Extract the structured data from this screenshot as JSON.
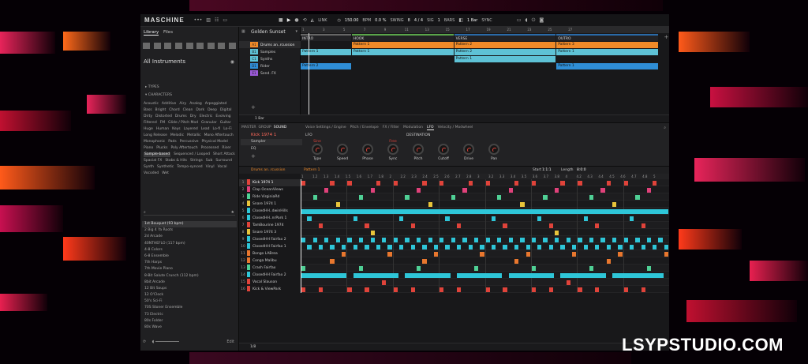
{
  "app": {
    "logo": "MASCHINE",
    "dots": "•••",
    "position": "1",
    "bpm": "150.00",
    "bpm_label": "BPM",
    "swing": "0.0 %",
    "swing_label": "SWING",
    "signature": "4 / 4",
    "signature_label": "SIG",
    "bar_num": "8",
    "bars_label": "BARS",
    "link_label": "LINK",
    "bar_length": "1 Bar",
    "sync_label": "SYNC",
    "accent": "#f08a28"
  },
  "browser": {
    "tabs": [
      "Library",
      "Files"
    ],
    "title": "All Instruments",
    "types_label": "TYPES",
    "characters_label": "CHARACTERS",
    "characters": [
      "Acoustic",
      "Additive",
      "Airy",
      "Analog",
      "Arpeggiated",
      "Bass",
      "Bright",
      "Chord",
      "Clean",
      "Dark",
      "Deep",
      "Digital",
      "Dirty",
      "Distorted",
      "Drums",
      "Dry",
      "Electric",
      "Evolving",
      "Filtered",
      "FM",
      "Glide / Pitch Mod",
      "Granular",
      "Guitar",
      "Huge",
      "Human",
      "Keys",
      "Layered",
      "Lead",
      "Lo-fi",
      "Lo-Fi",
      "Long Release",
      "Melodic",
      "Metallic",
      "Mono Aftertouch",
      "Monophonic",
      "Pads",
      "Percussive",
      "Physical Model",
      "Piano",
      "Plucks",
      "Poly Aftertouch",
      "Processed",
      "Riser",
      "Sample-based",
      "Sequenced / Looped",
      "Short Attack",
      "Spacial FX",
      "Stabs & Hits",
      "Strings",
      "Sub",
      "Surround",
      "Synth",
      "Synthetic",
      "Tempo-synced",
      "Vinyl",
      "Vocal",
      "Vocoded",
      "Wet"
    ],
    "selected_character": "Sample-based",
    "results": [
      "1st Bouquet (93 bpm)",
      "2 Big 4 Ya Roots",
      "2d Arcade",
      "40NTHEFLO (117 bpm)",
      "4-8 Colors",
      "6-8 Ensemble",
      "7th Harps",
      "7th Movie Piano",
      "8-Bit Salute Crunch (112 bpm)",
      "8bit Arcade",
      "12 Bit Soups",
      "12 O'Clock",
      "50's Sci-Fi",
      "70S Stoner Ensemble",
      "73 Electric",
      "80s Folder",
      "80s Wave"
    ],
    "selected_result": "1st Bouquet (93 bpm)",
    "edit_label": "Edit"
  },
  "arranger": {
    "song_name": "Golden Sunset",
    "groups": [
      {
        "code": "A1",
        "name": "Drums an..rcussion",
        "color": "#f08a28"
      },
      {
        "code": "B1",
        "name": "Samples",
        "color": "#5ec2d6"
      },
      {
        "code": "C1",
        "name": "Synths",
        "color": "#5ec2d6"
      },
      {
        "code": "D1",
        "name": "Rider",
        "color": "#2f8ed6"
      },
      {
        "code": "E1",
        "name": "Send. FX",
        "color": "#9a59d6"
      }
    ],
    "ticks": [
      "1",
      "3",
      "5",
      "7",
      "9",
      "11",
      "13",
      "15",
      "17",
      "19",
      "21",
      "23",
      "25",
      "27"
    ],
    "sections": [
      {
        "name": "INTRO",
        "color": "#666666"
      },
      {
        "name": "HOOK",
        "color": "#5aa54a"
      },
      {
        "name": "VERSE",
        "color": "#2a6aa8"
      },
      {
        "name": "OUTRO",
        "color": "#2a6aa8"
      }
    ],
    "patterns": [
      {
        "label": "Pattern 1",
        "row": 0,
        "start": 5,
        "end": 15,
        "color": "#f08a28"
      },
      {
        "label": "Pattern 2",
        "row": 0,
        "start": 15,
        "end": 25,
        "color": "#f08a28"
      },
      {
        "label": "Pattern 3",
        "row": 0,
        "start": 25,
        "end": 35,
        "color": "#f08a28"
      },
      {
        "label": "Pattern 1",
        "row": 1,
        "start": 0,
        "end": 5,
        "color": "#5ec2d6"
      },
      {
        "label": "Pattern 1",
        "row": 1,
        "start": 5,
        "end": 15,
        "color": "#5ec2d6"
      },
      {
        "label": "Pattern 2",
        "row": 1,
        "start": 15,
        "end": 25,
        "color": "#5ec2d6"
      },
      {
        "label": "Pattern 1",
        "row": 1,
        "start": 25,
        "end": 35,
        "color": "#5ec2d6"
      },
      {
        "label": "Pattern 1",
        "row": 2,
        "start": 15,
        "end": 25,
        "color": "#5ec2d6"
      },
      {
        "label": "Pattern 2",
        "row": 3,
        "start": 0,
        "end": 5,
        "color": "#2f8ed6"
      },
      {
        "label": "Pattern 1",
        "row": 3,
        "start": 25,
        "end": 35,
        "color": "#2f8ed6"
      }
    ],
    "footer": "1 Bar"
  },
  "sound": {
    "tabs": [
      "MASTER",
      "GROUP",
      "SOUND"
    ],
    "selected_tab": "SOUND",
    "name": "Kick 1974 1",
    "slots": [
      "Sampler",
      "EQ"
    ],
    "page_tabs": [
      "Voice Settings / Engine",
      "Pitch / Envelope",
      "FX / Filter",
      "Modulation",
      "LFO",
      "Velocity / Modwheel"
    ],
    "selected_page": "LFO",
    "lfo_label": "LFO",
    "destination_label": "DESTINATION",
    "params": [
      {
        "name": "Type",
        "value": "Sine"
      },
      {
        "name": "Speed",
        "value": ""
      },
      {
        "name": "Phase",
        "value": ""
      },
      {
        "name": "Sync",
        "value": "Free"
      },
      {
        "name": "Pitch",
        "value": ""
      },
      {
        "name": "Cutoff",
        "value": ""
      },
      {
        "name": "Drive",
        "value": ""
      },
      {
        "name": "Pan",
        "value": ""
      }
    ]
  },
  "pattern_editor": {
    "group_name": "Drums an..rcussion",
    "pattern_name": "Pattern 1",
    "start_label": "Start",
    "start_value": "1:1:1",
    "length_label": "Length",
    "length_value": "8:0:0",
    "ruler": [
      "1",
      "1.2",
      "1.3",
      "1.4",
      "1.5",
      "1.6",
      "1.7",
      "1.8",
      "2",
      "2.2",
      "2.3",
      "2.4",
      "2.5",
      "2.6",
      "2.7",
      "2.8",
      "3",
      "3.2",
      "3.3",
      "3.4",
      "3.5",
      "3.6",
      "3.7",
      "3.8",
      "4",
      "4.2",
      "4.3",
      "4.4",
      "4.5",
      "4.6",
      "4.7",
      "4.8",
      "5"
    ],
    "sounds": [
      {
        "name": "Kick 1974 1",
        "color": "#e0433a"
      },
      {
        "name": "Clap OceanViews",
        "color": "#e0417a"
      },
      {
        "name": "Ride VirginiaRd",
        "color": "#4fd095"
      },
      {
        "name": "Snare 1974 1",
        "color": "#e8c43a"
      },
      {
        "name": "ClosedHH..dwinHills",
        "color": "#2ec6d8"
      },
      {
        "name": "ClosedHH..nrPark 1",
        "color": "#2ec6d8"
      },
      {
        "name": "TamBourine 1974",
        "color": "#e0433a"
      },
      {
        "name": "Snare 1974 3",
        "color": "#e8c43a"
      },
      {
        "name": "ClosedHH Fairfax 2",
        "color": "#2ec6d8"
      },
      {
        "name": "ClosedHH Fairfax 1",
        "color": "#2ec6d8"
      },
      {
        "name": "Bongo LABrea",
        "color": "#e8772e"
      },
      {
        "name": "Conga Malibu",
        "color": "#e8772e"
      },
      {
        "name": "Crash Fairfax",
        "color": "#4fd095"
      },
      {
        "name": "ClosedHH Fairfax 2",
        "color": "#2ec6d8"
      },
      {
        "name": "Vocal Slauson",
        "color": "#e0433a"
      },
      {
        "name": "Kick & ViewPark",
        "color": "#e0433a"
      }
    ],
    "page": "1/8"
  },
  "watermark": "LSYPSTUDIO.COM"
}
